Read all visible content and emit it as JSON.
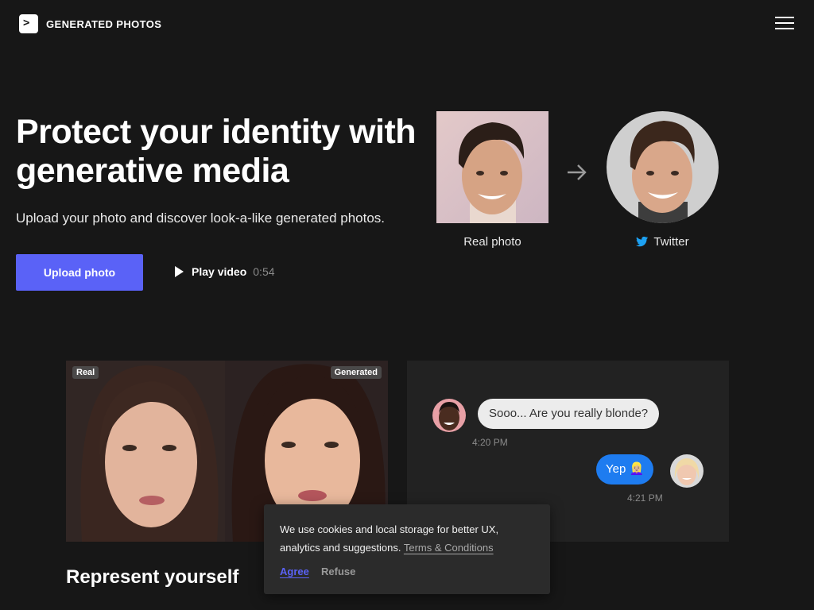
{
  "header": {
    "logo_glyph": ">",
    "logo_text": "GENERATED PHOTOS",
    "menu_icon": "hamburger-menu-icon"
  },
  "hero": {
    "title": "Protect your identity with generative media",
    "subtitle": "Upload your photo and discover look-a-like generated photos.",
    "upload_button": "Upload photo",
    "play_label": "Play video",
    "play_duration": "0:54"
  },
  "compare": {
    "real_label": "Real photo",
    "twitter_label": "Twitter",
    "twitter_icon": "twitter-bird-icon",
    "arrow_icon": "arrow-right-icon"
  },
  "showcase": {
    "tag_real": "Real",
    "tag_generated": "Generated",
    "heading": "Represent yourself"
  },
  "chat": {
    "message1": "Sooo... Are you really blonde?",
    "time1": "4:20 PM",
    "message2": "Yep 👱🏼‍♀️",
    "time2": "4:21 PM"
  },
  "cookie": {
    "text": "We use cookies and local storage for better UX, analytics and suggestions.",
    "link": "Terms & Conditions",
    "agree": "Agree",
    "refuse": "Refuse"
  },
  "colors": {
    "background": "#171717",
    "accent": "#5a62f7",
    "chat_blue": "#1e7cf0",
    "twitter_blue": "#1da1f2"
  }
}
